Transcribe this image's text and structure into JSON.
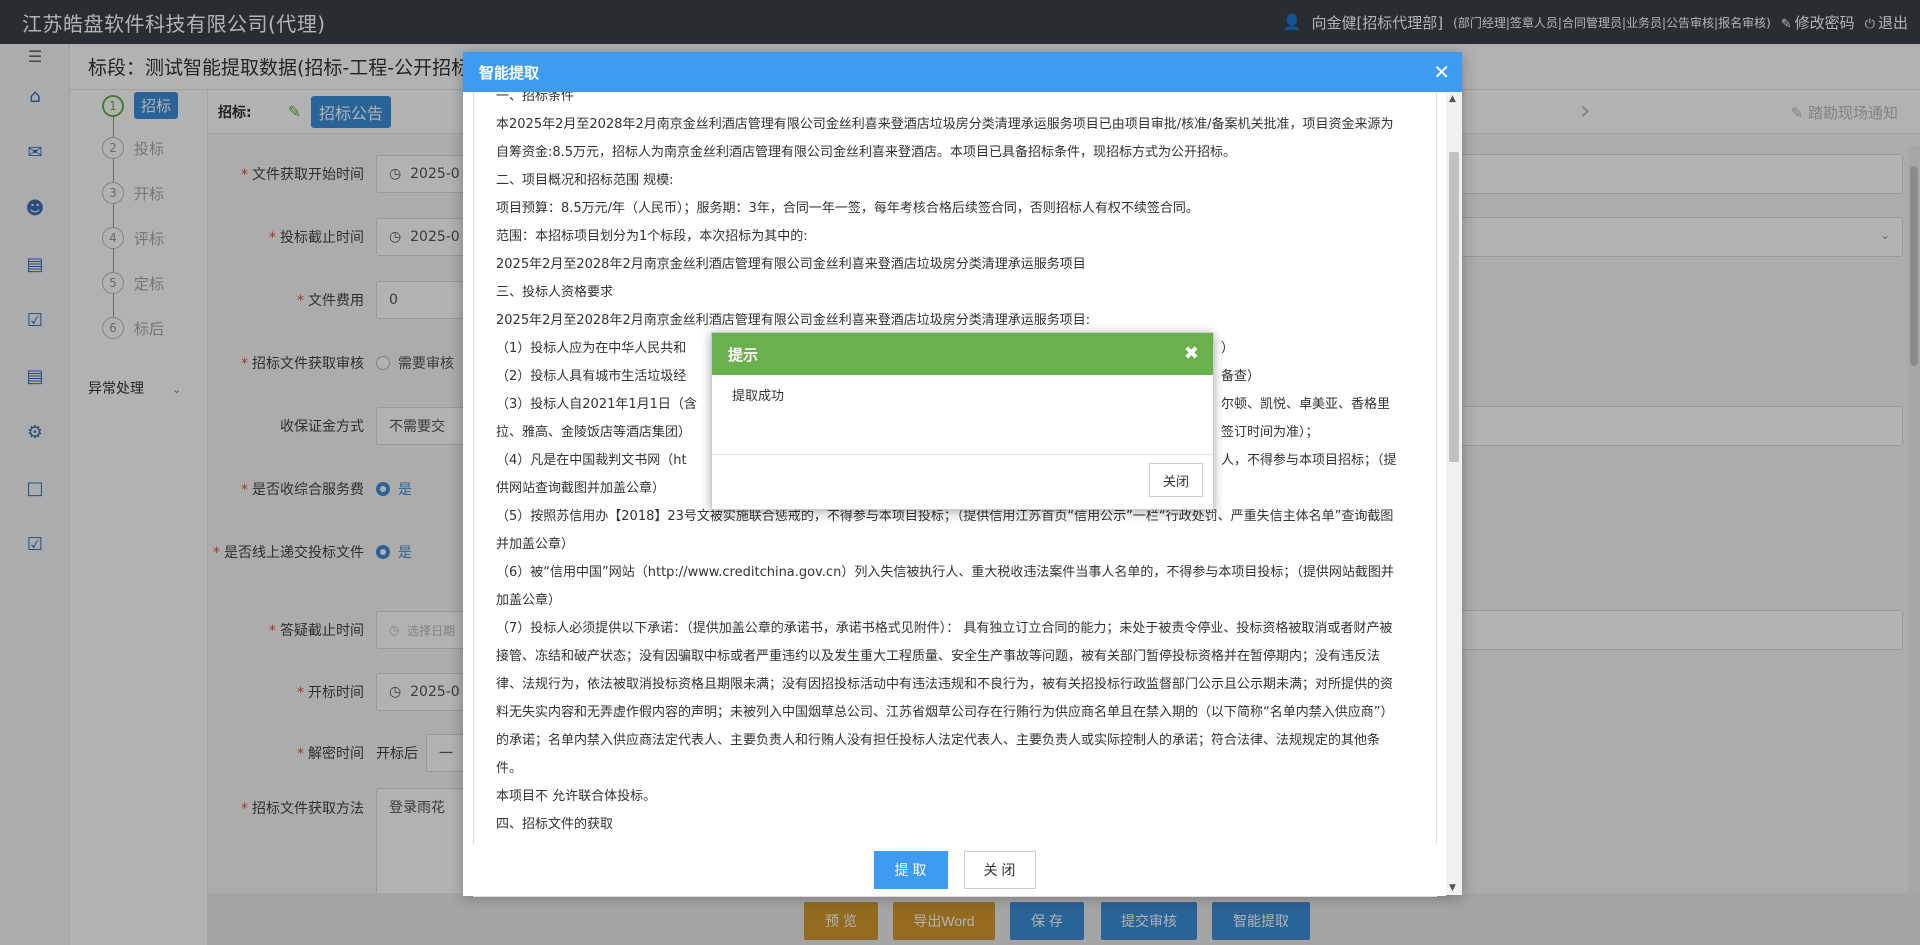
{
  "header": {
    "company": "江苏皓盘软件科技有限公司(代理)",
    "user": "向金健[招标代理部]",
    "roles": "(部门经理|签章人员|合同管理员|业务员|公告审核|报名审核)",
    "change_password": "修改密码",
    "logout": "退出"
  },
  "page": {
    "title": "标段：测试智能提取数据(招标-工程-公开招标-资"
  },
  "steps": {
    "items": [
      {
        "num": "1",
        "label": "招标"
      },
      {
        "num": "2",
        "label": "投标"
      },
      {
        "num": "3",
        "label": "开标"
      },
      {
        "num": "4",
        "label": "评标"
      },
      {
        "num": "5",
        "label": "定标"
      },
      {
        "num": "6",
        "label": "标后"
      }
    ],
    "exception": "异常处理"
  },
  "tabs": {
    "label": "招标:",
    "active": "招标公告",
    "survey": "踏勘现场通知"
  },
  "form": {
    "doc_start": {
      "label": "文件获取开始时间",
      "value": "2025-0"
    },
    "bid_deadline": {
      "label": "投标截止时间",
      "value": "2025-0"
    },
    "doc_fee": {
      "label": "文件费用",
      "value": "0"
    },
    "doc_review": {
      "label": "招标文件获取审核",
      "value": "需要审核"
    },
    "deposit": {
      "label": "收保证金方式",
      "value": "不需要交"
    },
    "service_fee": {
      "label": "是否收综合服务费",
      "value": "是"
    },
    "online_submit": {
      "label": "是否线上递交投标文件",
      "value": "是"
    },
    "qa_deadline": {
      "label": "答疑截止时间",
      "placeholder": "选择日期"
    },
    "open_time": {
      "label": "开标时间",
      "value": "2025-0"
    },
    "decrypt": {
      "label": "解密时间",
      "prefix": "开标后",
      "value": "一"
    },
    "method": {
      "label": "招标文件获取方法",
      "value": "登录雨花"
    }
  },
  "actions": {
    "preview": "预 览",
    "export_word": "导出Word",
    "save": "保 存",
    "submit_review": "提交审核",
    "smart_extract": "智能提取"
  },
  "dialog": {
    "title": "智能提取",
    "content": [
      "一、招标条件",
      "本2025年2月至2028年2月南京金丝利酒店管理有限公司金丝利喜来登酒店垃圾房分类清理承运服务项目已由项目审批/核准/备案机关批准，项目资金来源为自筹资金:8.5万元，招标人为南京金丝利酒店管理有限公司金丝利喜来登酒店。本项目已具备招标条件，现招标方式为公开招标。",
      "二、项目概况和招标范围 规模:",
      "项目预算：8.5万元/年（人民币）；服务期：3年，合同一年一签，每年考核合格后续签合同，否则招标人有权不续签合同。",
      "范围：本招标项目划分为1个标段，本次招标为其中的:",
      "2025年2月至2028年2月南京金丝利酒店管理有限公司金丝利喜来登酒店垃圾房分类清理承运服务项目",
      " 三、投标人资格要求",
      "2025年2月至2028年2月南京金丝利酒店管理有限公司金丝利喜来登酒店垃圾房分类清理承运服务项目:",
      "（1）投标人应为在中华人民共和",
      "（2）投标人具有城市生活垃圾经",
      "（3）投标人自2021年1月1日（含",
      "拉、雅高、金陵饭店等酒店集团）",
      "（4）凡是在中国裁判文书网（ht",
      "供网站查询截图并加盖公章）",
      "（5）按照苏信用办【2018】23号文被实施联合惩戒的，不得参与本项目投标；（提供信用江苏首页“信用公示”一栏“行政处罚、严重失信主体名单”查询截图并加盖公章）",
      "（6）被“信用中国”网站（http://www.creditchina.gov.cn）列入失信被执行人、重大税收违法案件当事人名单的，不得参与本项目投标；（提供网站截图并加盖公章）",
      "（7）投标人必须提供以下承诺：（提供加盖公章的承诺书，承诺书格式见附件）：  具有独立订立合同的能力；未处于被责令停业、投标资格被取消或者财产被接管、冻结和破产状态；没有因骗取中标或者严重违约以及发生重大工程质量、安全生产事故等问题，被有关部门暂停投标资格并在暂停期内；没有违反法律、法规行为，依法被取消投标资格且期限未满；没有因招投标活动中有违法违规和不良行为，被有关招投标行政监督部门公示且公示期未满；对所提供的资料无失实内容和无弄虚作假内容的声明；未被列入中国烟草总公司、江苏省烟草公司存在行贿行为供应商名单且在禁入期的（以下简称“名单内禁入供应商”）的承诺；名单内禁入供应商法定代表人、主要负责人和行贿人没有担任投标人法定代表人、主要负责人或实际控制人的承诺；符合法律、法规规定的其他条件。",
      "本项目不 允许联合体投标。",
      "四、招标文件的获取"
    ],
    "right_fragments": {
      "r1": "）",
      "r2": "备查）",
      "r3": "尔顿、凯悦、卓美亚、香格里",
      "r4": "签订时间为准）；",
      "r5": "人，不得参与本项目招标；（提"
    },
    "extract_btn": "提 取",
    "close_btn": "关 闭"
  },
  "toast": {
    "title": "提示",
    "message": "提取成功",
    "close_btn": "关闭"
  }
}
